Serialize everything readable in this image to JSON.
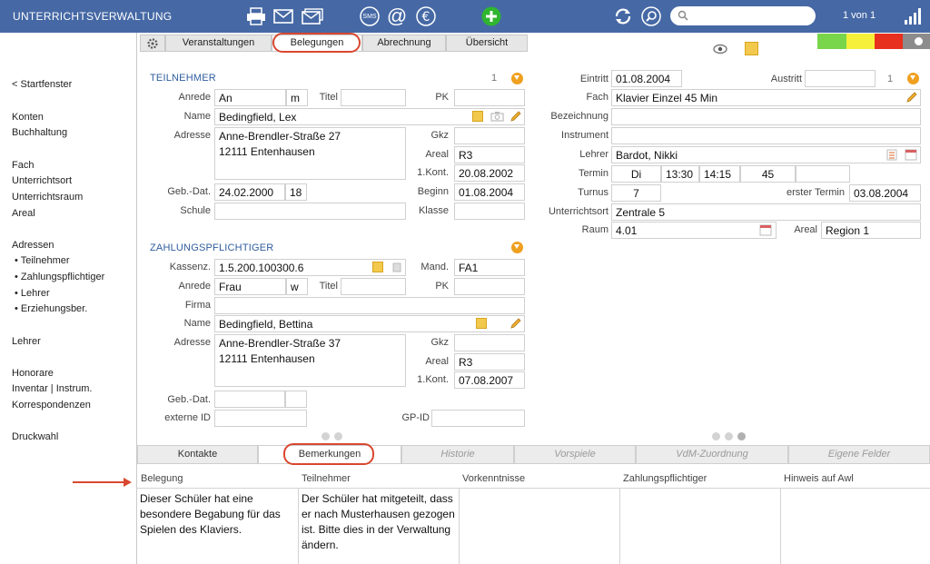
{
  "topbar": {
    "title": "UNTERRICHTSVERWALTUNG",
    "icons": [
      "printer-icon",
      "mail-icon",
      "mail-stack-icon",
      "sms-icon",
      "at-icon",
      "euro-icon",
      "add-icon",
      "refresh-icon",
      "search-icon",
      "signal-icon"
    ],
    "sms_label": "SMS",
    "search_placeholder": "",
    "pager": "1 von 1"
  },
  "sidebar": {
    "back": "< Startfenster",
    "items": [
      "Konten",
      "Buchhaltung",
      "Fach",
      "Unterrichtsort",
      "Unterrichtsraum",
      "Areal",
      "Adressen",
      "• Teilnehmer",
      "• Zahlungspflichtiger",
      "• Lehrer",
      "• Erziehungsber.",
      "Lehrer",
      "Honorare",
      "Inventar | Instrum.",
      "Korrespondenzen",
      "Druckwahl"
    ]
  },
  "tabs": [
    "Veranstaltungen",
    "Belegungen",
    "Abrechnung",
    "Übersicht"
  ],
  "status_colors": [
    "#79d64a",
    "#f7f03a",
    "#e8301e",
    "#8c8c8c"
  ],
  "teilnehmer": {
    "title": "TEILNEHMER",
    "count": "1",
    "labels": {
      "anrede": "Anrede",
      "titel": "Titel",
      "pk": "PK",
      "name": "Name",
      "adresse": "Adresse",
      "gkz": "Gkz",
      "areal": "Areal",
      "kont": "1.Kont.",
      "gebdat": "Geb.-Dat.",
      "beginn": "Beginn",
      "schule": "Schule",
      "klasse": "Klasse"
    },
    "anrede": "An",
    "geschlecht": "m",
    "titel": "",
    "pk": "",
    "name": "Bedingfield, Lex",
    "adresse_line1": "Anne-Brendler-Straße 27",
    "adresse_line2": "12111 Entenhausen",
    "gkz": "",
    "areal": "R3",
    "kont": "20.08.2002",
    "gebdat": "24.02.2000",
    "alter": "18",
    "beginn": "01.08.2004",
    "schule": "",
    "klasse": ""
  },
  "zahlung": {
    "title": "ZAHLUNGSPFLICHTIGER",
    "labels": {
      "kassenz": "Kassenz.",
      "mand": "Mand.",
      "anrede": "Anrede",
      "titel": "Titel",
      "pk": "PK",
      "firma": "Firma",
      "name": "Name",
      "adresse": "Adresse",
      "gkz": "Gkz",
      "areal": "Areal",
      "kont": "1.Kont.",
      "gebdat": "Geb.-Dat.",
      "externe_id": "externe ID",
      "gpid": "GP-ID"
    },
    "kassenz": "1.5.200.100300.6",
    "mand": "FA1",
    "anrede": "Frau",
    "geschlecht": "w",
    "titel": "",
    "pk": "",
    "firma": "",
    "name": "Bedingfield, Bettina",
    "adresse_line1": "Anne-Brendler-Straße 37",
    "adresse_line2": "12111 Entenhausen",
    "gkz": "",
    "areal": "R3",
    "kont": "07.08.2007",
    "gebdat": "",
    "externe_id": "",
    "gpid": ""
  },
  "belegung": {
    "labels": {
      "eintritt": "Eintritt",
      "austritt": "Austritt",
      "fach": "Fach",
      "bezeichnung": "Bezeichnung",
      "instrument": "Instrument",
      "lehrer": "Lehrer",
      "termin": "Termin",
      "turnus": "Turnus",
      "erster_termin": "erster Termin",
      "unterrichtsort": "Unterrichtsort",
      "raum": "Raum",
      "areal": "Areal"
    },
    "eintritt": "01.08.2004",
    "austritt": "",
    "count": "1",
    "fach": "Klavier Einzel 45 Min",
    "bezeichnung": "",
    "instrument": "",
    "lehrer": "Bardot, Nikki",
    "termin_tag": "Di",
    "termin_von": "13:30",
    "termin_bis": "14:15",
    "termin_dauer": "45",
    "termin_extra": "",
    "turnus": "7",
    "erster_termin": "03.08.2004",
    "unterrichtsort": "Zentrale 5",
    "raum": "4.01",
    "areal": "Region 1"
  },
  "lower_tabs": [
    "Kontakte",
    "Bemerkungen",
    "Historie",
    "Vorspiele",
    "VdM-Zuordnung",
    "Eigene Felder"
  ],
  "notes": {
    "headers": [
      "Belegung",
      "Teilnehmer",
      "Vorkenntnisse",
      "Zahlungspflichtiger",
      "Hinweis auf Awl"
    ],
    "belegung": "Dieser Schüler hat eine besondere Begabung für das Spielen des Klaviers.",
    "teilnehmer": "Der Schüler hat mitgeteilt, dass er nach Musterhausen gezogen ist. Bitte dies in der Verwaltung ändern.",
    "vorkenntnisse": "",
    "zahlungspflichtiger": "",
    "hinweis": ""
  }
}
